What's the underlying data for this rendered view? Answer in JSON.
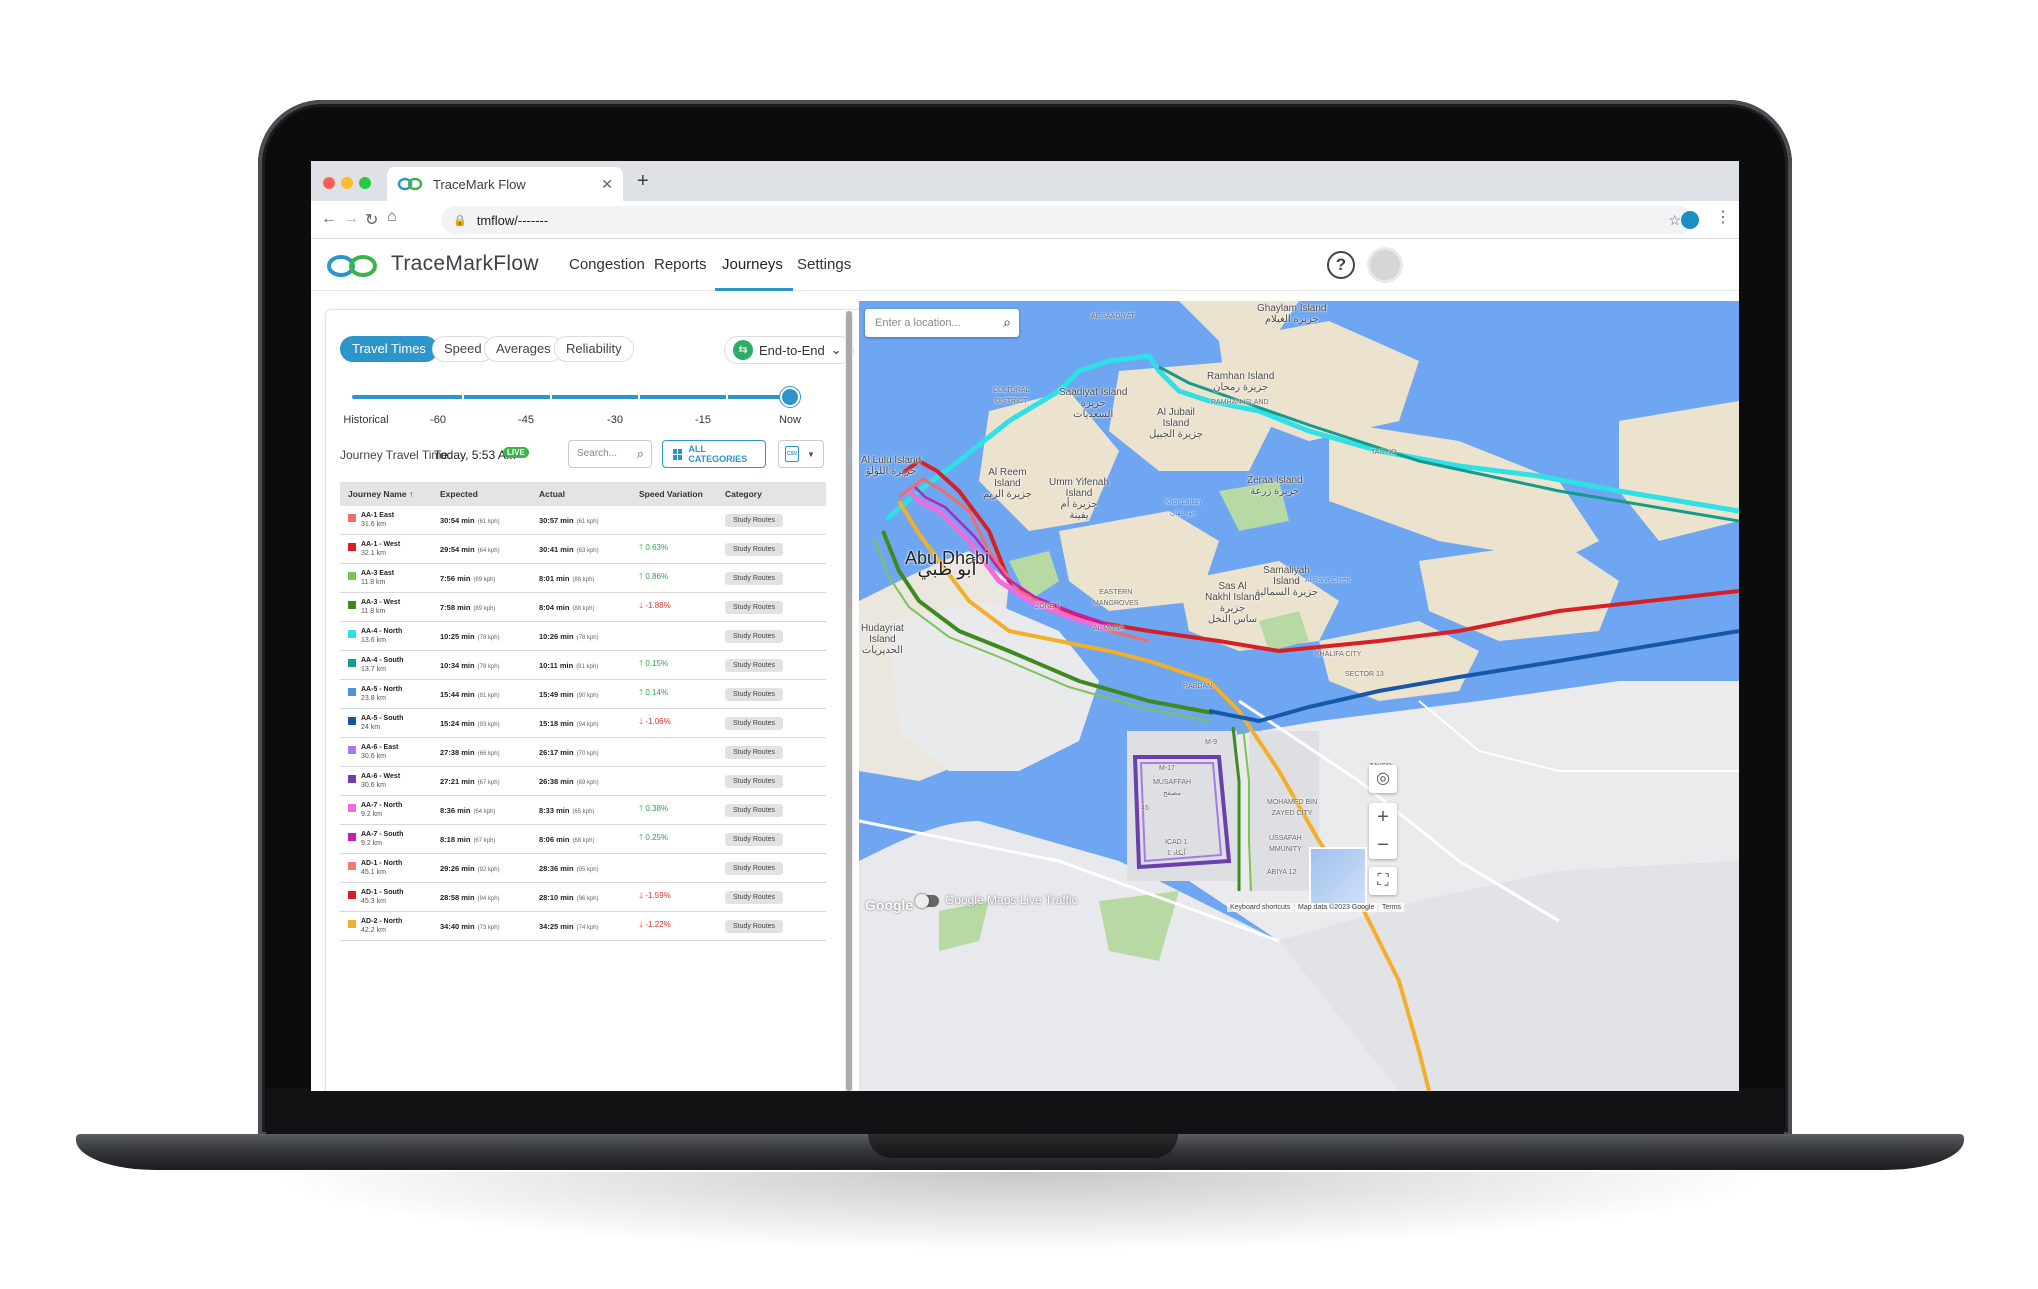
{
  "browser": {
    "tab_title": "TraceMark Flow",
    "tab_close": "✕",
    "new_tab": "+",
    "url": "tmflow/-------",
    "back": "←",
    "forward": "→",
    "reload": "↻",
    "home": "⌂",
    "lock": "🔒",
    "star": "☆",
    "menu": "⋮"
  },
  "app": {
    "brand": "TraceMarkFlow",
    "nav": [
      {
        "label": "Congestion"
      },
      {
        "label": "Reports"
      },
      {
        "label": "Journeys",
        "active": true
      },
      {
        "label": "Settings"
      }
    ],
    "help": "?"
  },
  "toolbar": {
    "tabs": [
      "Travel Times",
      "Speed",
      "Averages",
      "Reliability"
    ],
    "active_tab": "Travel Times",
    "mode": "End-to-End",
    "mode_icon": "⇆",
    "mode_caret": "⌄"
  },
  "slider": {
    "labels": [
      "Historical",
      "-60",
      "-45",
      "-30",
      "-15",
      "Now"
    ],
    "value_label": "Now"
  },
  "status": {
    "label": "Journey Travel Time:",
    "value": "Today, 5:53 AM",
    "badge": "LIVE"
  },
  "controls": {
    "search_placeholder": "Search...",
    "search_icon": "⌕",
    "all_categories": "ALL CATEGORIES",
    "csv_label": "CSV",
    "csv_caret": "▼"
  },
  "table": {
    "headers": [
      "Journey Name ↑",
      "Expected",
      "Actual",
      "Speed Variation",
      "Category"
    ],
    "rows": [
      {
        "color": "#f26b6b",
        "name": "AA-1 East",
        "dist": "31.6 km",
        "expected": "30:54 min",
        "expected_kph": "(61 kph)",
        "actual": "30:57 min",
        "actual_kph": "(61 kph)",
        "variation": "",
        "dir": "",
        "category": "Study Routes"
      },
      {
        "color": "#d71f26",
        "name": "AA-1 - West",
        "dist": "32.1 km",
        "expected": "29:54 min",
        "expected_kph": "(64 kph)",
        "actual": "30:41 min",
        "actual_kph": "(63 kph)",
        "variation": "0.63%",
        "dir": "up",
        "category": "Study Routes"
      },
      {
        "color": "#7fc255",
        "name": "AA-3 East",
        "dist": "11.8 km",
        "expected": "7:56 min",
        "expected_kph": "(89 kph)",
        "actual": "8:01 min",
        "actual_kph": "(88 kph)",
        "variation": "0.86%",
        "dir": "up",
        "category": "Study Routes"
      },
      {
        "color": "#3e8a1e",
        "name": "AA-3 - West",
        "dist": "11.8 km",
        "expected": "7:58 min",
        "expected_kph": "(89 kph)",
        "actual": "8:04 min",
        "actual_kph": "(88 kph)",
        "variation": "-1.88%",
        "dir": "down",
        "category": "Study Routes"
      },
      {
        "color": "#2fe0e6",
        "name": "AA-4 - North",
        "dist": "13.6 km",
        "expected": "10:25 min",
        "expected_kph": "(78 kph)",
        "actual": "10:26 min",
        "actual_kph": "(78 kph)",
        "variation": "",
        "dir": "",
        "category": "Study Routes"
      },
      {
        "color": "#159a8c",
        "name": "AA-4 - South",
        "dist": "13.7 km",
        "expected": "10:34 min",
        "expected_kph": "(78 kph)",
        "actual": "10:11 min",
        "actual_kph": "(81 kph)",
        "variation": "0.15%",
        "dir": "up",
        "category": "Study Routes"
      },
      {
        "color": "#4a94e0",
        "name": "AA-5 - North",
        "dist": "23.8 km",
        "expected": "15:44 min",
        "expected_kph": "(91 kph)",
        "actual": "15:49 min",
        "actual_kph": "(90 kph)",
        "variation": "0.14%",
        "dir": "up",
        "category": "Study Routes"
      },
      {
        "color": "#1657a8",
        "name": "AA-5 - South",
        "dist": "24 km",
        "expected": "15:24 min",
        "expected_kph": "(93 kph)",
        "actual": "15:18 min",
        "actual_kph": "(94 kph)",
        "variation": "-1.06%",
        "dir": "down",
        "category": "Study Routes"
      },
      {
        "color": "#a87ae8",
        "name": "AA-6 - East",
        "dist": "30.6 km",
        "expected": "27:38 min",
        "expected_kph": "(66 kph)",
        "actual": "26:17 min",
        "actual_kph": "(70 kph)",
        "variation": "",
        "dir": "",
        "category": "Study Routes"
      },
      {
        "color": "#6a3fb0",
        "name": "AA-6 - West",
        "dist": "30.6 km",
        "expected": "27:21 min",
        "expected_kph": "(67 kph)",
        "actual": "26:38 min",
        "actual_kph": "(69 kph)",
        "variation": "",
        "dir": "",
        "category": "Study Routes"
      },
      {
        "color": "#f06be0",
        "name": "AA-7 - North",
        "dist": "9.2 km",
        "expected": "8:36 min",
        "expected_kph": "(64 kph)",
        "actual": "8:33 min",
        "actual_kph": "(65 kph)",
        "variation": "0.38%",
        "dir": "up",
        "category": "Study Routes"
      },
      {
        "color": "#c21fb8",
        "name": "AA-7 - South",
        "dist": "9.2 km",
        "expected": "8:18 min",
        "expected_kph": "(67 kph)",
        "actual": "8:06 min",
        "actual_kph": "(68 kph)",
        "variation": "0.25%",
        "dir": "up",
        "category": "Study Routes"
      },
      {
        "color": "#f27a7a",
        "name": "AD-1 - North",
        "dist": "45.1 km",
        "expected": "29:26 min",
        "expected_kph": "(92 kph)",
        "actual": "28:36 min",
        "actual_kph": "(95 kph)",
        "variation": "",
        "dir": "",
        "category": "Study Routes"
      },
      {
        "color": "#d71f26",
        "name": "AD-1 - South",
        "dist": "45.3 km",
        "expected": "28:58 min",
        "expected_kph": "(94 kph)",
        "actual": "28:10 min",
        "actual_kph": "(96 kph)",
        "variation": "-1.59%",
        "dir": "down",
        "category": "Study Routes"
      },
      {
        "color": "#f2b02a",
        "name": "AD-2 - North",
        "dist": "42.2 km",
        "expected": "34:40 min",
        "expected_kph": "(73 kph)",
        "actual": "34:25 min",
        "actual_kph": "(74 kph)",
        "variation": "-1.22%",
        "dir": "down",
        "category": "Study Routes"
      }
    ]
  },
  "map": {
    "search_placeholder": "Enter a location...",
    "search_icon": "⌕",
    "zoom_in": "+",
    "zoom_out": "−",
    "locate_icon": "◎",
    "fullscreen_icon": "⛶",
    "google": "Google",
    "live_traffic": "Google Maps Live Traffic",
    "keyboard": "Keyboard shortcuts",
    "map_data": "Map data ©2023 Google",
    "terms": "Terms",
    "places": [
      {
        "text": "Ghaylam Island\nجزيرة الغيلام"
      },
      {
        "text": "Ramhan Island\nجزيرة رمحان"
      },
      {
        "text": "RAMHAN ISLAND"
      },
      {
        "text": "Saadiyat Island\nجزيرة\nالسعديات"
      },
      {
        "text": "Al Jubail\nIsland\nجزيرة الجبيل"
      },
      {
        "text": "Al Reem\nIsland\nجزيرة الريم"
      },
      {
        "text": "Umm Yifenah\nIsland\nجزيرة أم\nيفينة"
      },
      {
        "text": "Khor Laffan\nخور لفان"
      },
      {
        "text": "Zeraa Island\nجزيرة زرعة"
      },
      {
        "text": "Abu Dhabi\nأبو ظبي"
      },
      {
        "text": "Samaliyah\nIsland\nجزيرة السمالية"
      },
      {
        "text": "Sas Al\nNakhl Island\nجزيرة\nساس النخل"
      },
      {
        "text": "Hudayriat\nIsland\nالحديريات"
      },
      {
        "text": "Al Lulu Island\nجزيرة اللؤلؤ"
      },
      {
        "text": "MUSAFFAH\nمصفح"
      },
      {
        "text": "ICAD 1\nآيكاد 1"
      },
      {
        "text": "MOHAMED BIN\nZAYED CITY"
      },
      {
        "text": "KHALIFA CITY"
      },
      {
        "text": "SECTOR 13"
      },
      {
        "text": "ZONE 1"
      },
      {
        "text": "EASTERN\nMANGROVES"
      },
      {
        "text": "CULTURAL\nDISTRICT"
      },
      {
        "text": "AL MUNA"
      },
      {
        "text": "RABDAN"
      },
      {
        "text": "USSAFAH\nMMUNITY"
      },
      {
        "text": "ABIYA 12"
      },
      {
        "text": "M-17"
      },
      {
        "text": "M-9"
      },
      {
        "text": "45"
      },
      {
        "text": "ZAYED"
      },
      {
        "text": "TAS NO"
      },
      {
        "text": "AL SAADIYAT"
      },
      {
        "text": "Al Raha Creek"
      }
    ]
  }
}
